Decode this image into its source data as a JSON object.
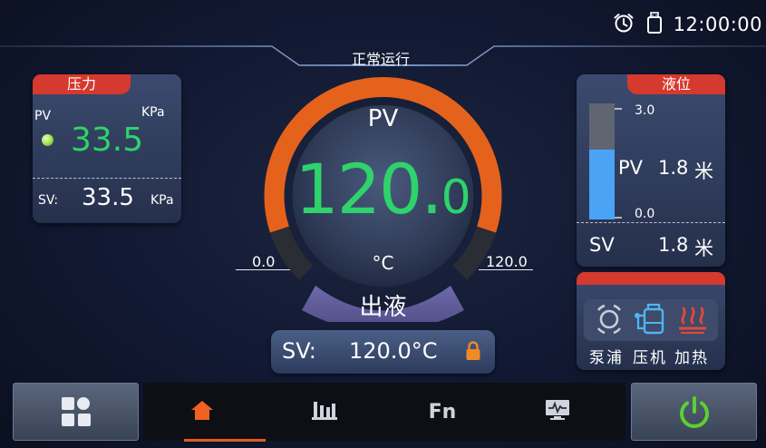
{
  "status_bar": {
    "time": "12:00:00",
    "icons": [
      "alarm-clock-icon",
      "usb-drive-icon"
    ]
  },
  "mode": {
    "label": "正常运行"
  },
  "pressure": {
    "tag": "压力",
    "pv_label": "PV",
    "unit": "KPa",
    "pv_value": "33.5",
    "sv_label": "SV:",
    "sv_value": "33.5",
    "sv_unit": "KPa",
    "indicator_color": "#9be04a"
  },
  "gauge": {
    "pv_label": "PV",
    "pv_value_int": "120.",
    "pv_value_dec": "0",
    "unit": "°C",
    "scale_min": "0.0",
    "scale_max": "120.0",
    "mode_text": "出液",
    "fill_fraction": 1.0,
    "arc_color": "#e5621c",
    "value_color": "#2ed36b"
  },
  "setpoint": {
    "label": "SV:",
    "value": "120.0°C",
    "lock_icon": "lock-icon",
    "lock_color": "#f08a24"
  },
  "level": {
    "tag": "液位",
    "max_tick": "3.0",
    "min_tick": "0.0",
    "pv_label": "PV",
    "pv_value": "1.8",
    "pv_unit": "米",
    "sv_label": "SV",
    "sv_value": "1.8",
    "sv_unit": "米",
    "fill_fraction": 0.6,
    "fill_color": "#4aa3f5"
  },
  "devices": [
    {
      "label": "泵浦",
      "icon": "pump-icon",
      "color": "#c9ced9"
    },
    {
      "label": "压机",
      "icon": "compressor-icon",
      "color": "#4db6f2"
    },
    {
      "label": "加热",
      "icon": "heater-icon",
      "color": "#e5473a"
    }
  ],
  "nav": {
    "tabs": [
      {
        "label": "home",
        "icon": "home-icon",
        "active": true
      },
      {
        "label": "trend",
        "icon": "bar-chart-icon",
        "active": false
      },
      {
        "label": "Fn",
        "icon": "function-icon",
        "active": false
      },
      {
        "label": "monitor",
        "icon": "monitor-icon",
        "active": false
      }
    ],
    "power_color": "#5bd12f"
  }
}
